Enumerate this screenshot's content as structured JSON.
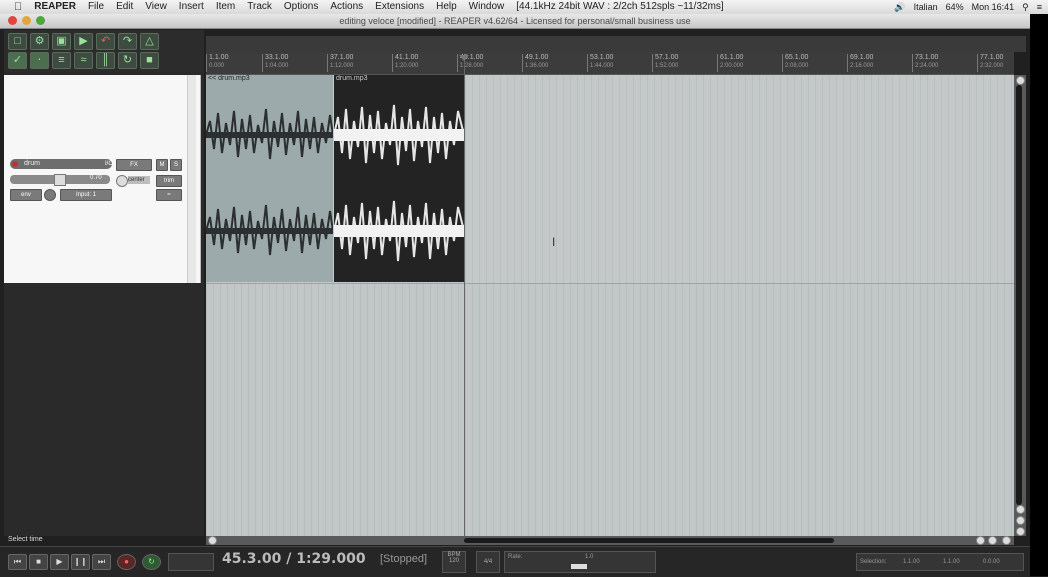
{
  "menubar": {
    "apple": "",
    "app": "REAPER",
    "items": [
      "File",
      "Edit",
      "View",
      "Insert",
      "Item",
      "Track",
      "Options",
      "Actions",
      "Extensions",
      "Help",
      "Window"
    ],
    "audio_info": "[44.1kHz 24bit WAV : 2/2ch 512spls ~11/32ms]",
    "input_lang": "Italian",
    "battery": "64%",
    "clock": "Mon 16:41"
  },
  "window": {
    "title": "editing veloce [modified] - REAPER v4.62/64 - Licensed for personal/small business use"
  },
  "toolbar": {
    "icons": [
      "new-project",
      "open",
      "save",
      "undo",
      "redo",
      "metronome",
      "grid-snap",
      "ripple-edit",
      "lock-item",
      "auto-crossfade",
      "loop-icon",
      "lock-icon"
    ]
  },
  "track": {
    "name": "drum",
    "io_label": "I/O",
    "mute": "M",
    "solo": "S",
    "volume": "0.70",
    "pan_label": "center",
    "fx": "FX",
    "trim": "trim",
    "input": "Input: 1",
    "env": "env"
  },
  "ruler": {
    "ticks": [
      {
        "bar": "1.1.00",
        "time": "0.000"
      },
      {
        "bar": "33.1.00",
        "time": "1:04.000"
      },
      {
        "bar": "37.1.00",
        "time": "1:12.000"
      },
      {
        "bar": "41.1.00",
        "time": "1:20.000"
      },
      {
        "bar": "45.1.00",
        "time": "1:28.000"
      },
      {
        "bar": "49.1.00",
        "time": "1:36.000"
      },
      {
        "bar": "53.1.00",
        "time": "1:44.000"
      },
      {
        "bar": "57.1.00",
        "time": "1:52.000"
      },
      {
        "bar": "61.1.00",
        "time": "2:00.000"
      },
      {
        "bar": "65.1.00",
        "time": "2:08.000"
      },
      {
        "bar": "69.1.00",
        "time": "2:16.000"
      },
      {
        "bar": "73.1.00",
        "time": "2:24.000"
      },
      {
        "bar": "77.1.00",
        "time": "2:32.000"
      }
    ]
  },
  "items": [
    {
      "label": "<< drum.mp3"
    },
    {
      "label": "drum.mp3"
    }
  ],
  "status": {
    "text": "Select time"
  },
  "transport": {
    "position": "45.3.00 / 1:29.000",
    "state": "[Stopped]",
    "bpm_label": "BPM",
    "bpm": "120",
    "timesig": "4/4",
    "rate_label": "Rate:",
    "rate": "1.0",
    "selection_label": "Selection:",
    "sel_start": "1.1.00",
    "sel_end": "1.1.00",
    "sel_len": "0.0.00"
  },
  "colors": {
    "accent_green": "#9be09f",
    "record_red": "#cc3333",
    "arrange_bg": "#c1c6c6"
  }
}
